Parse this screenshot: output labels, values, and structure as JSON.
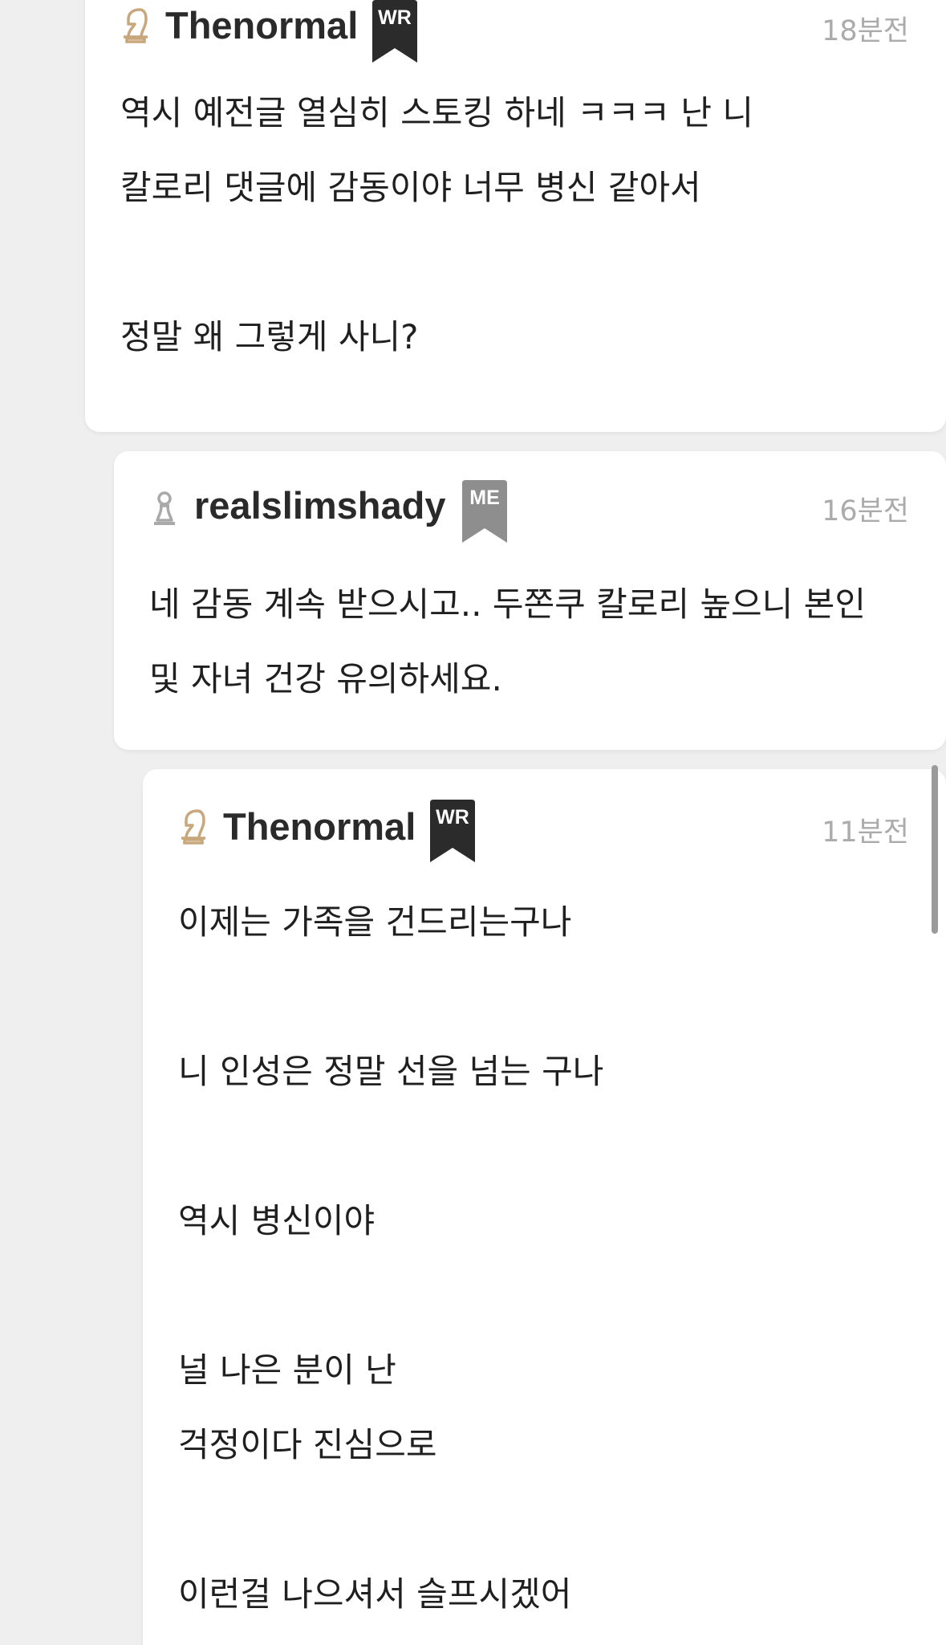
{
  "comments": [
    {
      "username": "Thenormal",
      "badge": "WR",
      "badge_color": "#2b2b2b",
      "icon": "knight-chess-icon",
      "icon_color": "#c9a77c",
      "time": "18분전",
      "lines": [
        "역시 예전글 열심히 스토킹 하네 ㅋㅋㅋ 난 니",
        "칼로리 댓글에 감동이야 너무 병신 같아서",
        "",
        "정말 왜 그렇게 사니?"
      ]
    },
    {
      "username": "realslimshady",
      "badge": "ME",
      "badge_color": "#8e8e8e",
      "icon": "pawn-chess-icon",
      "icon_color": "#a9a9a9",
      "time": "16분전",
      "lines": [
        "네 감동 계속 받으시고.. 두쫀쿠 칼로리 높으니 본인",
        "및 자녀 건강 유의하세요."
      ]
    },
    {
      "username": "Thenormal",
      "badge": "WR",
      "badge_color": "#2b2b2b",
      "icon": "knight-chess-icon",
      "icon_color": "#c9a77c",
      "time": "11분전",
      "lines": [
        "이제는 가족을 건드리는구나",
        "",
        "니 인성은 정말 선을 넘는 구나",
        "",
        "역시 병신이야",
        "",
        "널 나은 분이 난",
        "걱정이다 진심으로",
        "",
        "이런걸 나으셔서 슬프시겠어"
      ]
    }
  ]
}
